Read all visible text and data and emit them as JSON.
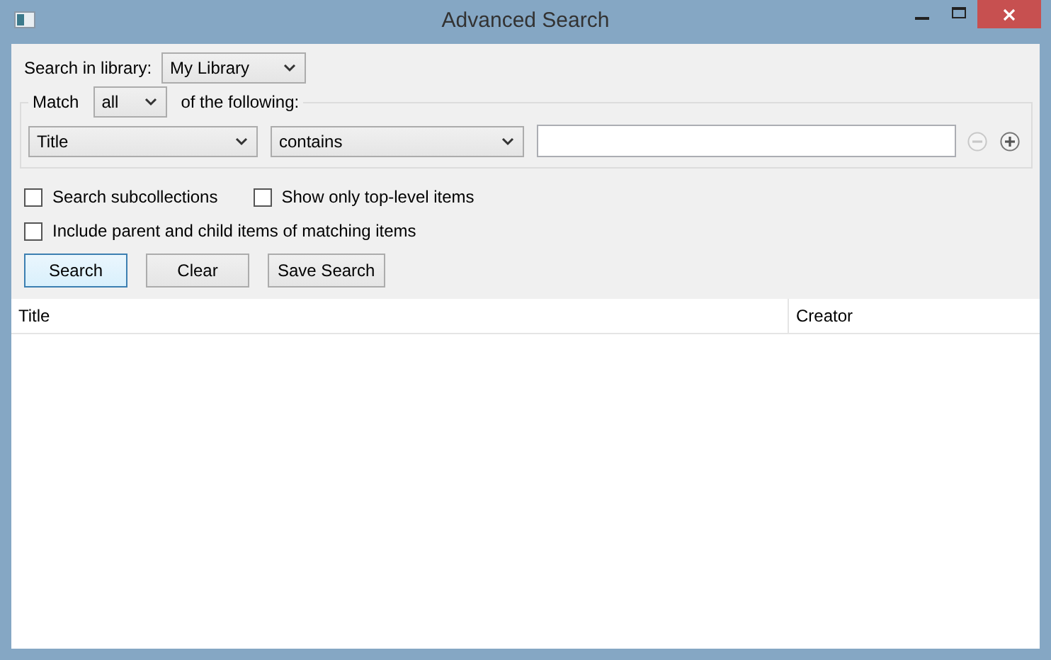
{
  "window": {
    "title": "Advanced Search"
  },
  "library": {
    "label": "Search in library:",
    "value": "My Library"
  },
  "match": {
    "label": "Match",
    "value": "all",
    "suffix": "of the following:"
  },
  "conditions": [
    {
      "field": "Title",
      "operator": "contains",
      "remove_disabled": true
    }
  ],
  "options": [
    {
      "label": "Search subcollections",
      "checked": false
    },
    {
      "label": "Show only top-level items",
      "checked": false
    },
    {
      "label": "Include parent and child items of matching items",
      "checked": false
    }
  ],
  "buttons": [
    {
      "label": "Search",
      "focused": true
    },
    {
      "label": "Clear",
      "focused": false
    },
    {
      "label": "Save Search",
      "focused": false
    }
  ],
  "table": {
    "columns": [
      "Title",
      "Creator"
    ]
  }
}
